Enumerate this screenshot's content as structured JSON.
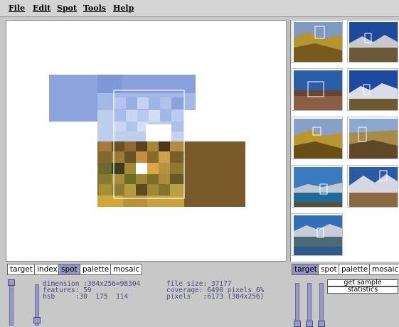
{
  "menu": {
    "items": [
      "File",
      "Edit",
      "Spot",
      "Tools",
      "Help"
    ]
  },
  "left_tabs": [
    "target",
    "index",
    "spot",
    "palette",
    "mosaic"
  ],
  "left_active_tab": "spot",
  "right_tabs": [
    "target",
    "spot",
    "palette",
    "mosaic"
  ],
  "right_active_tab": "target",
  "info": {
    "dimension": "dimension :384x256=98304",
    "features": "features: 59",
    "hsb": "hsb     :30  175  114",
    "file_size": "file size: 37177",
    "coverage": "coverage: 6490 pixels 6%",
    "pixels": "pixels   :6173 (384x256)"
  },
  "buttons": {
    "get_sample": "get sample",
    "statistics": "statistics"
  },
  "colors": {
    "active_tab": "#9494c4",
    "slider": "#9999c8",
    "info_text": "#4a4a80"
  }
}
